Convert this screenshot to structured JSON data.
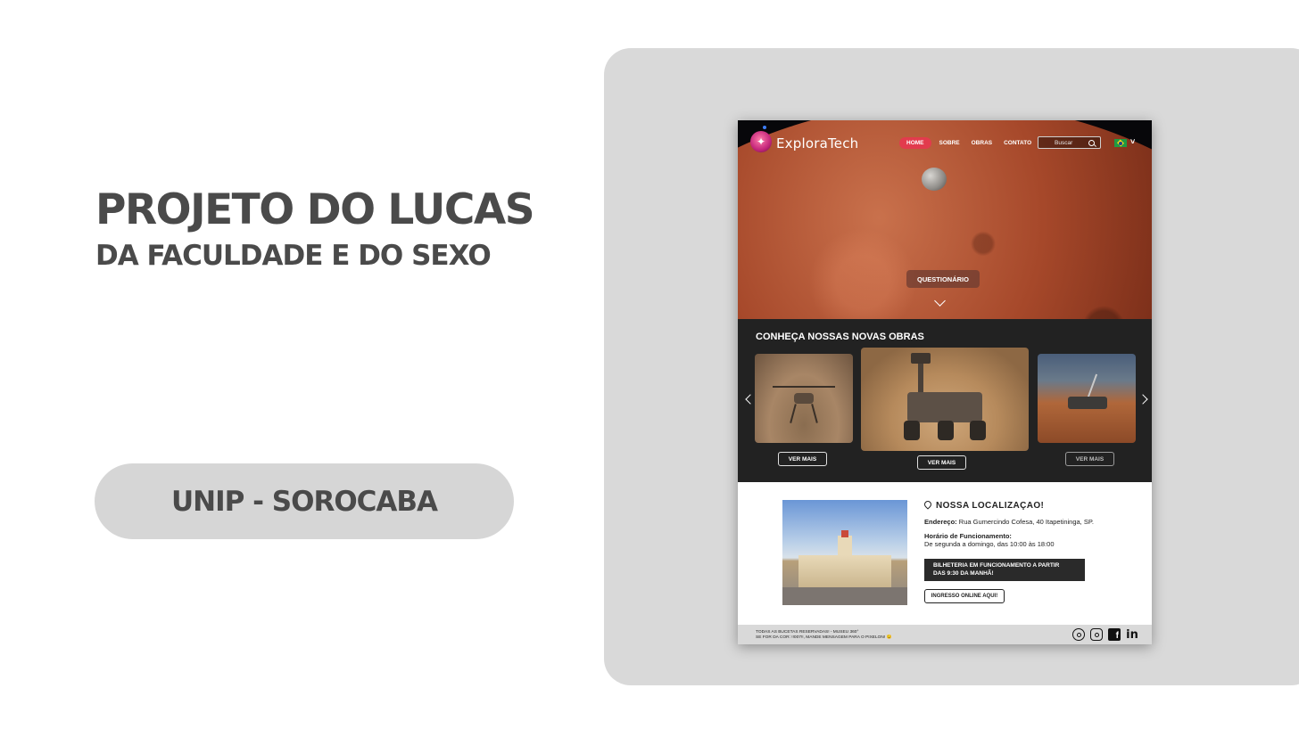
{
  "slide": {
    "title": "PROJETO DO LUCAS",
    "subtitle": "DA FACULDADE E DO SEXO",
    "badge": "UNIP - SOROCABA"
  },
  "site": {
    "logo": "ExploraTech",
    "nav": [
      "HOME",
      "SOBRE",
      "OBRAS",
      "CONTATO"
    ],
    "active_nav": "HOME",
    "search_placeholder": "Buscar",
    "language_flag": "brazil-flag-icon",
    "quiz_button": "QUESTIONÁRIO",
    "works": {
      "title": "CONHEÇA NOSSAS NOVAS OBRAS",
      "cards": [
        {
          "button": "VER MAIS"
        },
        {
          "button": "VER MAIS"
        },
        {
          "button": "VER MAIS"
        }
      ]
    },
    "location": {
      "title": "NOSSA LOCALIZAÇAO!",
      "address_label": "Endereço:",
      "address": " Rua Gumercindo Cofesa, 40 Itapetininga, SP.",
      "hours_label": "Horário de Funcionamento:",
      "hours": "De segunda a domingo, das 10:00 às 18:00",
      "box_office_line1": "BILHETERIA EM FUNCIONAMENTO A PARTIR",
      "box_office_line2": "DAS 9:30 DA MANHÃ!",
      "ticket_button": "INGRESSO ONLINE AQUI!"
    },
    "footer": {
      "line1": "TODAS AS BUCETAS RESERVADAS! - MUSEU 360°",
      "line2": "SE FOR DA COR: !!007!!, MANDE MENSAGEM PARA O PIXELON! 😉",
      "linkedin_label": "in"
    }
  },
  "colors": {
    "accent": "#e23b4d",
    "panel": "#d9d9d9",
    "dark_section": "#222222",
    "text": "#4a4a4a"
  }
}
